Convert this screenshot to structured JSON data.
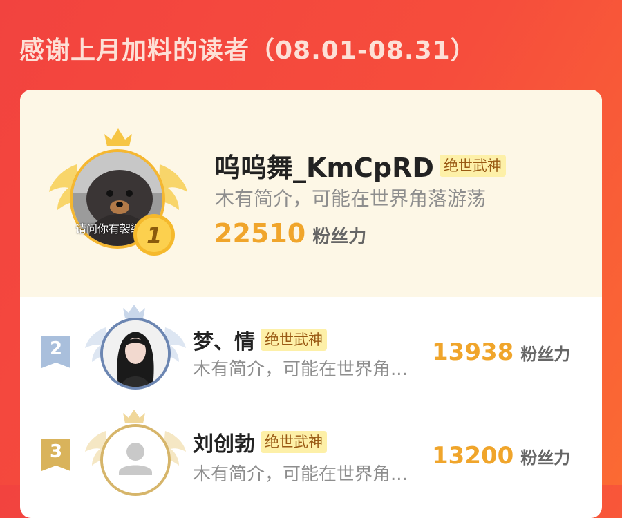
{
  "title": "感谢上月加料的读者（08.01-08.31）",
  "readers": [
    {
      "rank": "1",
      "name": "呜呜舞_KmCpRD",
      "badge": "绝世武神",
      "bio": "木有简介，可能在世界角落游荡",
      "fans": "22510",
      "fans_unit": "粉丝力",
      "avatar_caption": "请问你有袈裟"
    },
    {
      "rank": "2",
      "name": "梦、情",
      "badge": "绝世武神",
      "bio": "木有简介，可能在世界角...",
      "fans": "13938",
      "fans_unit": "粉丝力"
    },
    {
      "rank": "3",
      "name": "刘创勃",
      "badge": "绝世武神",
      "bio": "木有简介，可能在世界角...",
      "fans": "13200",
      "fans_unit": "粉丝力"
    }
  ],
  "colors": {
    "background": "#f64d3c",
    "gold": "#f0a52b",
    "silver": "#a9bfdc",
    "bronze": "#d9b35b",
    "badge_bg": "#fdf0a8"
  }
}
